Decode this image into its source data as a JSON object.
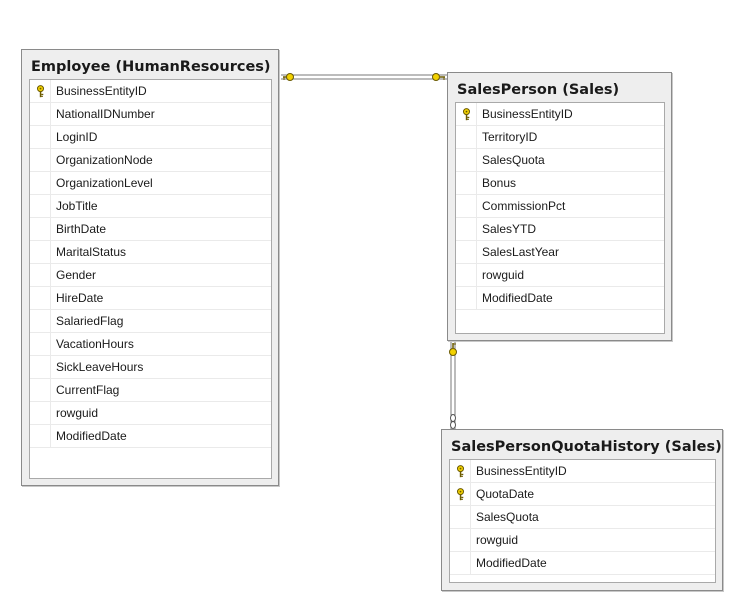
{
  "tables": {
    "employee": {
      "title": "Employee (HumanResources)",
      "columns": [
        {
          "name": "BusinessEntityID",
          "icon": "primary-key-icon"
        },
        {
          "name": "NationalIDNumber"
        },
        {
          "name": "LoginID"
        },
        {
          "name": "OrganizationNode"
        },
        {
          "name": "OrganizationLevel"
        },
        {
          "name": "JobTitle"
        },
        {
          "name": "BirthDate"
        },
        {
          "name": "MaritalStatus"
        },
        {
          "name": "Gender"
        },
        {
          "name": "HireDate"
        },
        {
          "name": "SalariedFlag"
        },
        {
          "name": "VacationHours"
        },
        {
          "name": "SickLeaveHours"
        },
        {
          "name": "CurrentFlag"
        },
        {
          "name": "rowguid"
        },
        {
          "name": "ModifiedDate"
        }
      ]
    },
    "salesperson": {
      "title": "SalesPerson (Sales)",
      "columns": [
        {
          "name": "BusinessEntityID",
          "icon": "primary-key-icon"
        },
        {
          "name": "TerritoryID"
        },
        {
          "name": "SalesQuota"
        },
        {
          "name": "Bonus"
        },
        {
          "name": "CommissionPct"
        },
        {
          "name": "SalesYTD"
        },
        {
          "name": "SalesLastYear"
        },
        {
          "name": "rowguid"
        },
        {
          "name": "ModifiedDate"
        }
      ]
    },
    "quota_history": {
      "title": "SalesPersonQuotaHistory (Sales)",
      "columns": [
        {
          "name": "BusinessEntityID",
          "icon": "primary-key-icon"
        },
        {
          "name": "QuotaDate",
          "icon": "primary-key-icon"
        },
        {
          "name": "SalesQuota"
        },
        {
          "name": "rowguid"
        },
        {
          "name": "ModifiedDate"
        }
      ]
    }
  },
  "relationships": [
    {
      "from": "employee",
      "to": "salesperson",
      "from_end": "key-icon",
      "to_end": "key-icon"
    },
    {
      "from": "salesperson",
      "to": "quota_history",
      "from_end": "key-icon",
      "to_end": "infinity-icon"
    }
  ],
  "colors": {
    "key": "#e8c800",
    "connector": "#7a7a7a",
    "table_bg": "#eeeeee",
    "table_border": "#8a8a8a"
  }
}
